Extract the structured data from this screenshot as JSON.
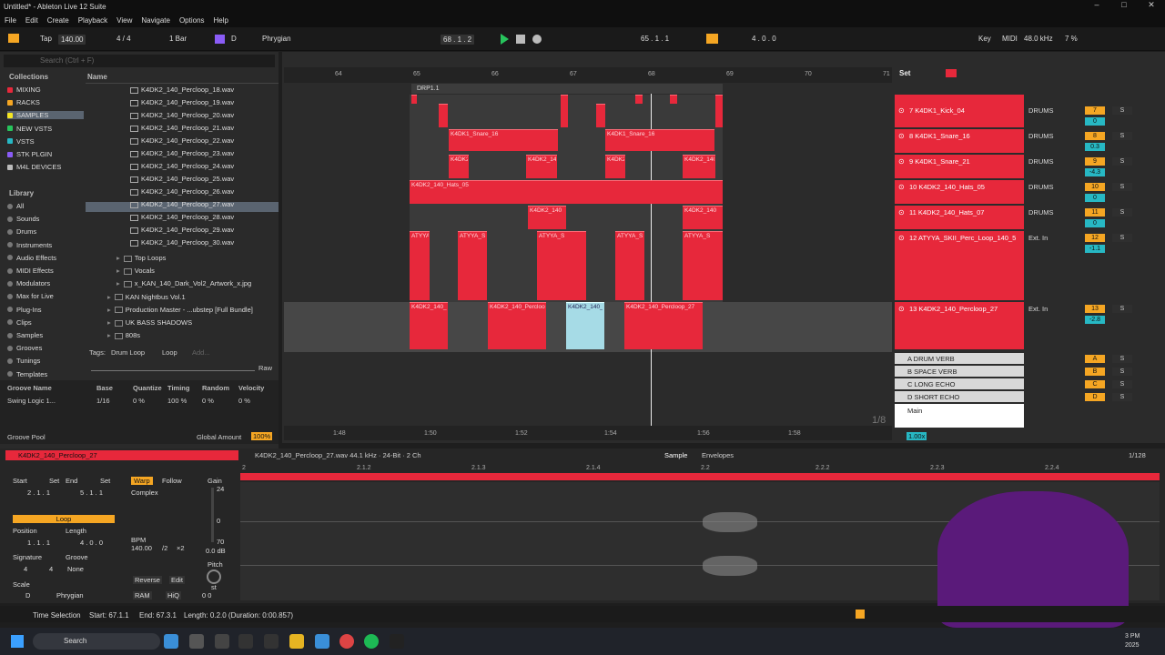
{
  "window": {
    "title": "Untitled* - Ableton Live 12 Suite",
    "min": "–",
    "max": "□",
    "close": "✕"
  },
  "menu": [
    "File",
    "Edit",
    "Create",
    "Playback",
    "View",
    "Navigate",
    "Options",
    "Help"
  ],
  "toolbar": {
    "tap": "Tap",
    "tempo": "140.00",
    "sig": "4 / 4",
    "quant": "1 Bar",
    "key": "D",
    "scale": "Phrygian",
    "pos": "68 .  1 .  2",
    "loop_start": "65 .  1 .  1",
    "loop_len": "4 .  0 .  0",
    "key_btn": "Key",
    "midi": "MIDI",
    "rate": "48.0 kHz",
    "cpu": "7 %"
  },
  "browser": {
    "search_placeholder": "Search (Ctrl + F)",
    "collections_label": "Collections",
    "name_header": "Name",
    "collections": [
      {
        "label": "MIXING",
        "color": "#e7283b"
      },
      {
        "label": "RACKS",
        "color": "#f5a623"
      },
      {
        "label": "SAMPLES",
        "color": "#f5e623"
      },
      {
        "label": "NEW VSTS",
        "color": "#27c45c"
      },
      {
        "label": "VSTS",
        "color": "#27b8c4"
      },
      {
        "label": "STK PLGIN",
        "color": "#8a5cf6"
      },
      {
        "label": "M4L DEVICES",
        "color": "#bbbbbb"
      }
    ],
    "library_label": "Library",
    "library": [
      "All",
      "Sounds",
      "Drums",
      "Instruments",
      "Audio Effects",
      "MIDI Effects",
      "Modulators",
      "Max for Live",
      "Plug-Ins",
      "Clips",
      "Samples",
      "Grooves",
      "Tunings",
      "Templates"
    ],
    "files": [
      "K4DK2_140_Percloop_18.wav",
      "K4DK2_140_Percloop_19.wav",
      "K4DK2_140_Percloop_20.wav",
      "K4DK2_140_Percloop_21.wav",
      "K4DK2_140_Percloop_22.wav",
      "K4DK2_140_Percloop_23.wav",
      "K4DK2_140_Percloop_24.wav",
      "K4DK2_140_Percloop_25.wav",
      "K4DK2_140_Percloop_26.wav",
      "K4DK2_140_Percloop_27.wav",
      "K4DK2_140_Percloop_28.wav",
      "K4DK2_140_Percloop_29.wav",
      "K4DK2_140_Percloop_30.wav"
    ],
    "folders": [
      "Top Loops",
      "Vocals",
      "x_KAN_140_Dark_Vol2_Artwork_x.jpg",
      "KAN Nightbus Vol.1",
      "Production Master - ...ubstep [Full Bundle]",
      "UK BASS SHADOWS",
      "808s"
    ],
    "tags_label": "Tags:",
    "tag1": "Drum Loop",
    "tag2": "Loop",
    "add": "Add...",
    "raw": "Raw",
    "groove_headers": [
      "Groove Name",
      "Base",
      "Quantize",
      "Timing",
      "Random",
      "Velocity"
    ],
    "groove_row": [
      "Swing Logic 1...",
      "1/16",
      "0 %",
      "100 %",
      "0 %",
      "0 %"
    ],
    "groove_pool": "Groove Pool",
    "global_amount": "Global Amount",
    "global_val": "100%"
  },
  "arrangement": {
    "bars": [
      "64",
      "65",
      "66",
      "67",
      "68",
      "69",
      "70",
      "71"
    ],
    "times": [
      "1:48",
      "1:50",
      "1:52",
      "1:54",
      "1:56",
      "1:58"
    ],
    "locator": "DRP1.1",
    "set": "Set",
    "fraction": "1/8",
    "zoom": "1.00x",
    "tracks": [
      {
        "name": "7 K4DK1_Kick_04",
        "group": "DRUMS",
        "num": "7",
        "vol": "0"
      },
      {
        "name": "8 K4DK1_Snare_16",
        "group": "DRUMS",
        "num": "8",
        "vol": "0.3"
      },
      {
        "name": "9 K4DK1_Snare_21",
        "group": "DRUMS",
        "num": "9",
        "vol": "-4.3"
      },
      {
        "name": "10 K4DK2_140_Hats_05",
        "group": "DRUMS",
        "num": "10",
        "vol": "0"
      },
      {
        "name": "11 K4DK2_140_Hats_07",
        "group": "DRUMS",
        "num": "11",
        "vol": "0"
      },
      {
        "name": "12 ATYYA_SKII_Perc_Loop_140_5",
        "group": "Ext. In",
        "num": "12",
        "vol": "-1.1"
      },
      {
        "name": "13 K4DK2_140_Percloop_27",
        "group": "Ext. In",
        "num": "13",
        "vol": "-2.8"
      }
    ],
    "returns": [
      {
        "name": "A DRUM VERB",
        "letter": "A"
      },
      {
        "name": "B SPACE VERB",
        "letter": "B"
      },
      {
        "name": "C LONG ECHO",
        "letter": "C"
      },
      {
        "name": "D SHORT ECHO",
        "letter": "D"
      }
    ],
    "main": "Main",
    "clip_labels": {
      "snare16": "K4DK1_Snare_16",
      "hats05": "K4DK2_140_Hats_05",
      "atyya": "ATYYA_S",
      "percloop": "K4DK2_140_Percloop_27",
      "k4d": "K4DK2_140"
    }
  },
  "detail": {
    "clip_name": "K4DK2_140_Percloop_27",
    "sample_info": "K4DK2_140_Percloop_27.wav  44.1 kHz · 24-Bit · 2 Ch",
    "tab_sample": "Sample",
    "tab_env": "Envelopes",
    "grid": "1/128",
    "ruler": [
      "2",
      "2.1.2",
      "2.1.3",
      "2.1.4",
      "2.2",
      "2.2.2",
      "2.2.3",
      "2.2.4"
    ],
    "start": "Start",
    "end": "End",
    "set": "Set",
    "start_val": "2 .  1 .  1",
    "end_val": "5 .  1 .  1",
    "warp": "Warp",
    "follow": "Follow",
    "mode": "Complex",
    "loop": "Loop",
    "position": "Position",
    "length": "Length",
    "pos_val": "1 .  1 .  1",
    "len_val": "4 .  0 .  0",
    "signature": "Signature",
    "groove": "Groove",
    "sig_n": "4",
    "sig_d": "4",
    "groove_val": "None",
    "bpm": "BPM",
    "bpm_val": "140.00",
    "half": "/2",
    "double": "×2",
    "gain": "Gain",
    "gain_top": "24",
    "gain_mid": "0",
    "gain_bot": "70",
    "gain_val": "0.0 dB",
    "pitch": "Pitch",
    "st": "st",
    "reverse": "Reverse",
    "edit": "Edit",
    "ram": "RAM",
    "hiq": "HiQ",
    "scale": "Scale",
    "scale_key": "D",
    "scale_name": "Phrygian",
    "detune": "0   0"
  },
  "status": {
    "label": "Time Selection",
    "start": "Start: 67.1.1",
    "end": "End: 67.3.1",
    "length": "Length: 0.2.0 (Duration: 0:00.857)"
  },
  "taskbar": {
    "search": "Search",
    "time": "3 PM",
    "year": "2025"
  },
  "colors": {
    "clip": "#e7283b",
    "accent": "#f5a623",
    "teal": "#27b8c4"
  }
}
